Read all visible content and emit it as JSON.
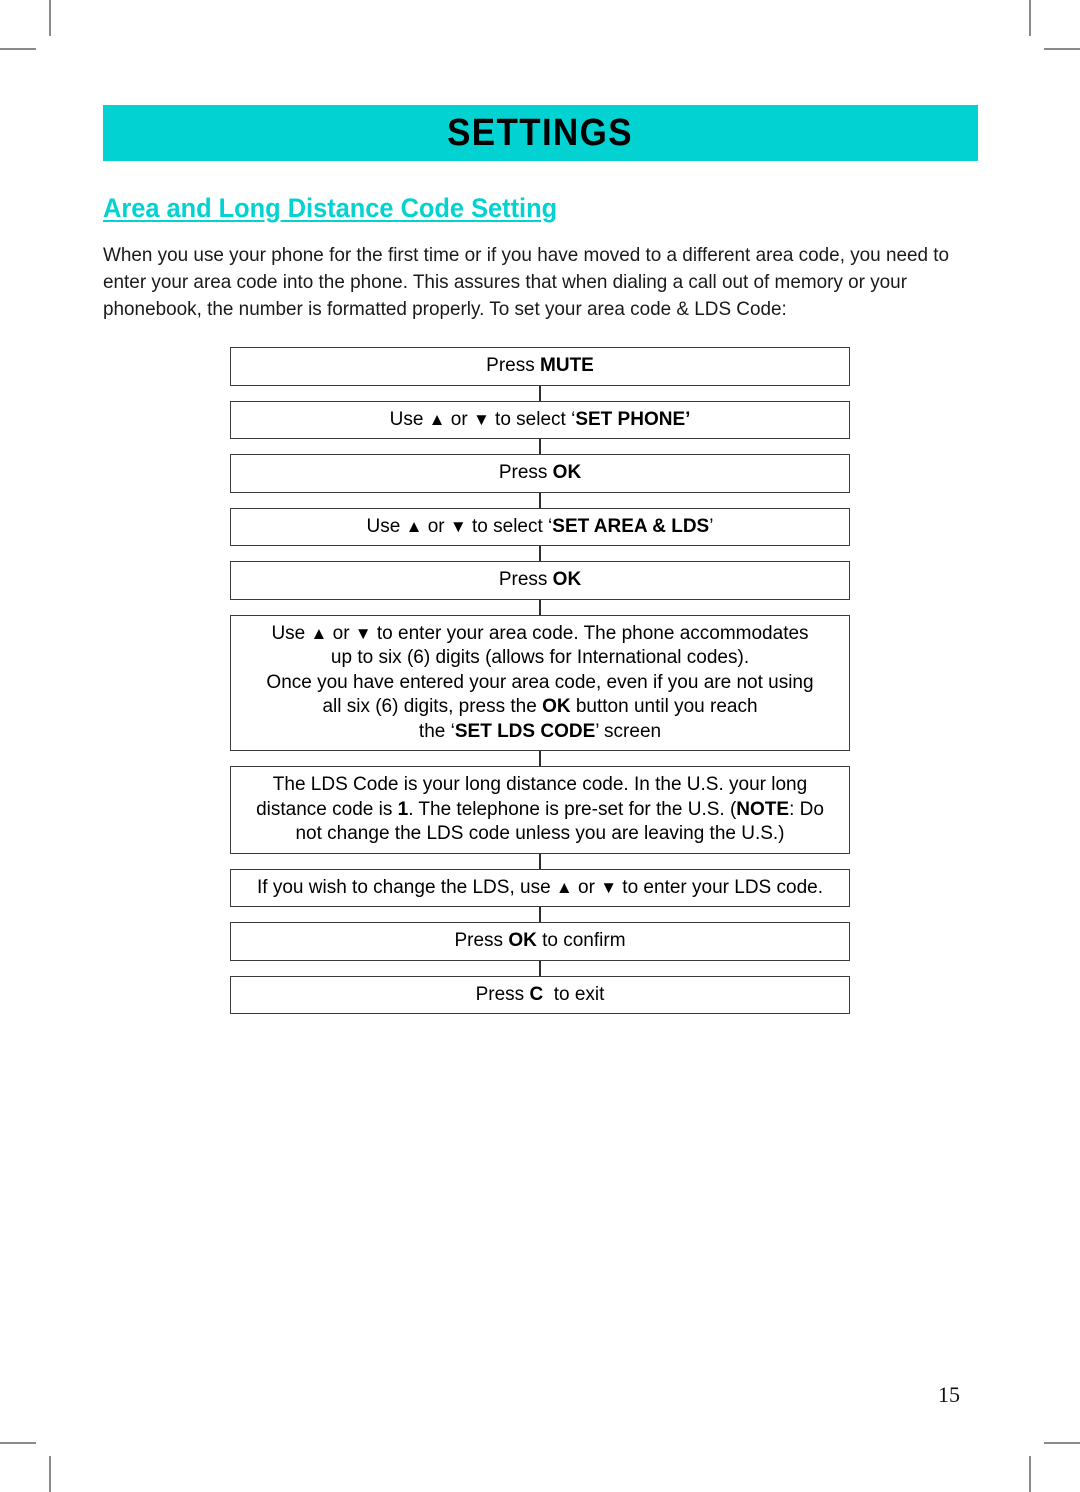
{
  "document": {
    "banner_title": "SETTINGS",
    "section_heading": "Area and Long Distance Code Setting",
    "page_number": "15",
    "accent_color": "#02d2d2",
    "intro_paragraph": "When you use your phone for the first time or if you have moved to a different area code, you need to enter your area code into the phone. This assures that when dialing a call out of memory or your phonebook, the number is formatted properly. To set your area code & LDS Code:"
  },
  "flow": {
    "steps": [
      {
        "id": "press-mute",
        "lines": [
          [
            {
              "t": "Press ",
              "b": false
            },
            {
              "t": "MUTE",
              "b": true
            }
          ]
        ]
      },
      {
        "id": "select-set-phone",
        "lines": [
          [
            {
              "t": "Use ",
              "b": false
            },
            {
              "t": "▲",
              "b": false
            },
            {
              "t": " or ",
              "b": false
            },
            {
              "t": "▼",
              "b": false
            },
            {
              "t": " to select ‘",
              "b": false
            },
            {
              "t": "SET PHONE’",
              "b": true
            }
          ]
        ]
      },
      {
        "id": "press-ok-1",
        "lines": [
          [
            {
              "t": "Press ",
              "b": false
            },
            {
              "t": "OK",
              "b": true
            }
          ]
        ]
      },
      {
        "id": "select-set-area-lds",
        "lines": [
          [
            {
              "t": "Use ",
              "b": false
            },
            {
              "t": "▲",
              "b": false
            },
            {
              "t": " or ",
              "b": false
            },
            {
              "t": "▼",
              "b": false
            },
            {
              "t": " to select ‘",
              "b": false
            },
            {
              "t": "SET AREA & LDS",
              "b": true
            },
            {
              "t": "’",
              "b": false
            }
          ]
        ]
      },
      {
        "id": "press-ok-2",
        "lines": [
          [
            {
              "t": "Press ",
              "b": false
            },
            {
              "t": "OK",
              "b": true
            }
          ]
        ]
      },
      {
        "id": "enter-area-code",
        "lines": [
          [
            {
              "t": "Use ",
              "b": false
            },
            {
              "t": "▲",
              "b": false
            },
            {
              "t": " or ",
              "b": false
            },
            {
              "t": "▼",
              "b": false
            },
            {
              "t": " to enter your area code. The phone accommodates",
              "b": false
            }
          ],
          [
            {
              "t": "up to six (6) digits (allows for International codes).",
              "b": false
            }
          ],
          [
            {
              "t": "Once you have entered your area code, even if you are not using",
              "b": false
            }
          ],
          [
            {
              "t": "all six (6) digits, press the ",
              "b": false
            },
            {
              "t": "OK",
              "b": true
            },
            {
              "t": " button until you reach",
              "b": false
            }
          ],
          [
            {
              "t": "the ‘",
              "b": false
            },
            {
              "t": "SET LDS CODE",
              "b": true
            },
            {
              "t": "’ screen",
              "b": false
            }
          ]
        ]
      },
      {
        "id": "lds-code-explanation",
        "lines": [
          [
            {
              "t": "The LDS Code is your long distance code. In the U.S. your long",
              "b": false
            }
          ],
          [
            {
              "t": "distance code is ",
              "b": false
            },
            {
              "t": "1",
              "b": true
            },
            {
              "t": ". The telephone is pre-set for the U.S. (",
              "b": false
            },
            {
              "t": "NOTE",
              "b": true
            },
            {
              "t": ": Do",
              "b": false
            }
          ],
          [
            {
              "t": "not change the LDS code unless you are leaving the U.S.)",
              "b": false
            }
          ]
        ]
      },
      {
        "id": "change-lds",
        "lines": [
          [
            {
              "t": "If you wish to change the LDS, use ",
              "b": false
            },
            {
              "t": "▲",
              "b": false
            },
            {
              "t": " or ",
              "b": false
            },
            {
              "t": "▼",
              "b": false
            },
            {
              "t": " to enter your LDS code.",
              "b": false
            }
          ]
        ]
      },
      {
        "id": "press-ok-confirm",
        "lines": [
          [
            {
              "t": "Press ",
              "b": false
            },
            {
              "t": "OK",
              "b": true
            },
            {
              "t": " to confirm",
              "b": false
            }
          ]
        ]
      },
      {
        "id": "press-c-exit",
        "lines": [
          [
            {
              "t": "Press ",
              "b": false
            },
            {
              "t": "C",
              "b": true
            },
            {
              "t": "  to exit",
              "b": false
            }
          ]
        ]
      }
    ]
  }
}
